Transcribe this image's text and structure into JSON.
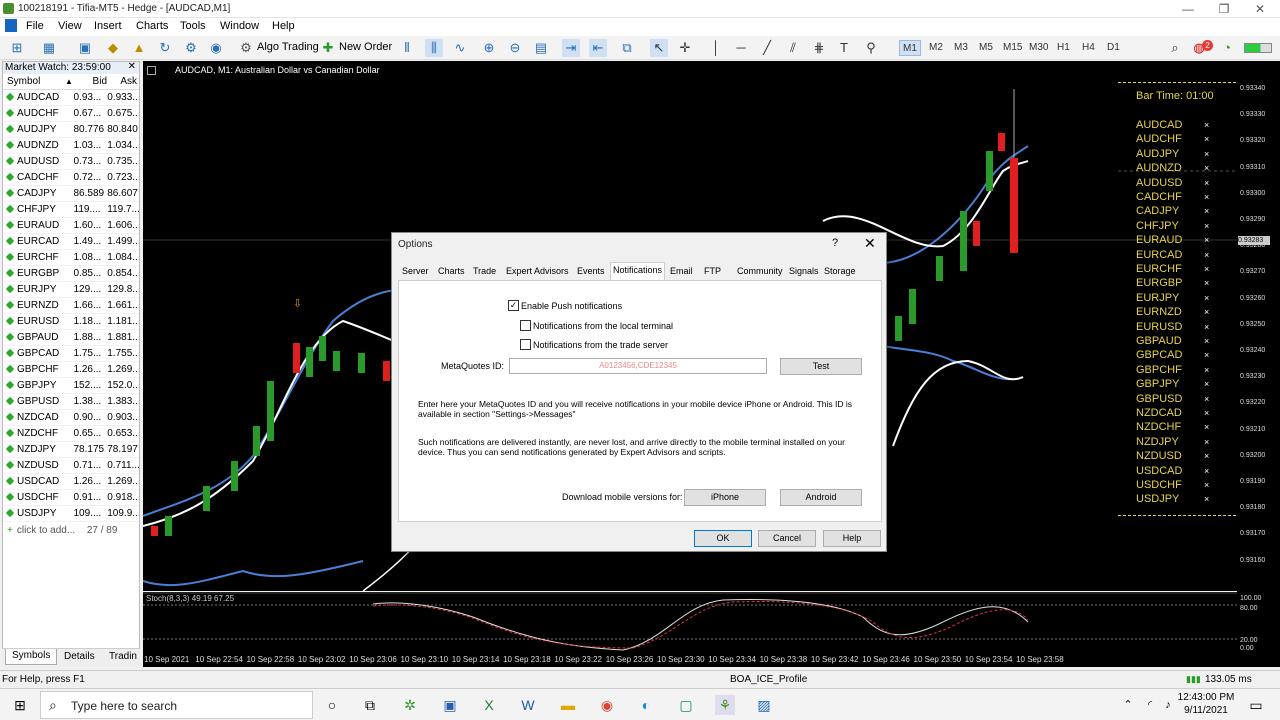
{
  "window": {
    "title": "100218191 - Tifia-MT5 - Hedge - [AUDCAD,M1]"
  },
  "menu": [
    "File",
    "View",
    "Insert",
    "Charts",
    "Tools",
    "Window",
    "Help"
  ],
  "toolbar": {
    "algo_trading": "Algo Trading",
    "new_order": "New Order",
    "timeframes": [
      "M1",
      "M2",
      "M3",
      "M5",
      "M15",
      "M30",
      "H1",
      "H4",
      "D1"
    ],
    "active_timeframe": "M1",
    "notif_count": "2"
  },
  "market_watch": {
    "title": "Market Watch: 23:59:00",
    "headers": {
      "symbol": "Symbol",
      "bid": "Bid",
      "ask": "Ask"
    },
    "rows": [
      {
        "symbol": "AUDCAD",
        "bid": "0.93...",
        "ask": "0.933..."
      },
      {
        "symbol": "AUDCHF",
        "bid": "0.67...",
        "ask": "0.675..."
      },
      {
        "symbol": "AUDJPY",
        "bid": "80.776",
        "ask": "80.840"
      },
      {
        "symbol": "AUDNZD",
        "bid": "1.03...",
        "ask": "1.034..."
      },
      {
        "symbol": "AUDUSD",
        "bid": "0.73...",
        "ask": "0.735..."
      },
      {
        "symbol": "CADCHF",
        "bid": "0.72...",
        "ask": "0.723..."
      },
      {
        "symbol": "CADJPY",
        "bid": "86.589",
        "ask": "86.607"
      },
      {
        "symbol": "CHFJPY",
        "bid": "119....",
        "ask": "119.7..."
      },
      {
        "symbol": "EURAUD",
        "bid": "1.60...",
        "ask": "1.606..."
      },
      {
        "symbol": "EURCAD",
        "bid": "1.49...",
        "ask": "1.499..."
      },
      {
        "symbol": "EURCHF",
        "bid": "1.08...",
        "ask": "1.084..."
      },
      {
        "symbol": "EURGBP",
        "bid": "0.85...",
        "ask": "0.854..."
      },
      {
        "symbol": "EURJPY",
        "bid": "129....",
        "ask": "129.8..."
      },
      {
        "symbol": "EURNZD",
        "bid": "1.66...",
        "ask": "1.661..."
      },
      {
        "symbol": "EURUSD",
        "bid": "1.18...",
        "ask": "1.181..."
      },
      {
        "symbol": "GBPAUD",
        "bid": "1.88...",
        "ask": "1.881..."
      },
      {
        "symbol": "GBPCAD",
        "bid": "1.75...",
        "ask": "1.755..."
      },
      {
        "symbol": "GBPCHF",
        "bid": "1.26...",
        "ask": "1.269..."
      },
      {
        "symbol": "GBPJPY",
        "bid": "152....",
        "ask": "152.0..."
      },
      {
        "symbol": "GBPUSD",
        "bid": "1.38...",
        "ask": "1.383..."
      },
      {
        "symbol": "NZDCAD",
        "bid": "0.90...",
        "ask": "0.903..."
      },
      {
        "symbol": "NZDCHF",
        "bid": "0.65...",
        "ask": "0.653..."
      },
      {
        "symbol": "NZDJPY",
        "bid": "78.175",
        "ask": "78.197"
      },
      {
        "symbol": "NZDUSD",
        "bid": "0.71...",
        "ask": "0.711..."
      },
      {
        "symbol": "USDCAD",
        "bid": "1.26...",
        "ask": "1.269..."
      },
      {
        "symbol": "USDCHF",
        "bid": "0.91...",
        "ask": "0.918..."
      },
      {
        "symbol": "USDJPY",
        "bid": "109....",
        "ask": "109.9..."
      }
    ],
    "add_label": "click to add...",
    "count": "27 / 89",
    "tabs": [
      "Symbols",
      "Details",
      "Tradin"
    ]
  },
  "chart": {
    "title": "AUDCAD, M1:  Australian Dollar vs Canadian Dollar",
    "price_labels": [
      "0.93340",
      "0.93330",
      "0.93320",
      "0.93310",
      "0.93300",
      "0.93290",
      "0.93280",
      "0.93270",
      "0.93260",
      "0.93250",
      "0.93240",
      "0.93230",
      "0.93220",
      "0.93210",
      "0.93200",
      "0.93190",
      "0.93180",
      "0.93170",
      "0.93160"
    ],
    "current_price": "0.93283",
    "stoch_label": "Stoch(8,3,3) 49.19 67.25",
    "stoch_levels": [
      "100.00",
      "80.00",
      "20.00",
      "0.00"
    ],
    "time_labels": [
      "10 Sep 2021",
      "10 Sep 22:54",
      "10 Sep 22:58",
      "10 Sep 23:02",
      "10 Sep 23:06",
      "10 Sep 23:10",
      "10 Sep 23:14",
      "10 Sep 23:18",
      "10 Sep 23:22",
      "10 Sep 23:26",
      "10 Sep 23:30",
      "10 Sep 23:34",
      "10 Sep 23:38",
      "10 Sep 23:42",
      "10 Sep 23:46",
      "10 Sep 23:50",
      "10 Sep 23:54",
      "10 Sep 23:58"
    ],
    "panel": {
      "bar_time": "Bar Time: 01:00",
      "symbols": [
        "AUDCAD",
        "AUDCHF",
        "AUDJPY",
        "AUDNZD",
        "AUDUSD",
        "CADCHF",
        "CADJPY",
        "CHFJPY",
        "EURAUD",
        "EURCAD",
        "EURCHF",
        "EURGBP",
        "EURJPY",
        "EURNZD",
        "EURUSD",
        "GBPAUD",
        "GBPCAD",
        "GBPCHF",
        "GBPJPY",
        "GBPUSD",
        "NZDCAD",
        "NZDCHF",
        "NZDJPY",
        "NZDUSD",
        "USDCAD",
        "USDCHF",
        "USDJPY"
      ],
      "remove_glyph": "×"
    }
  },
  "dialog": {
    "title": "Options",
    "help_glyph": "?",
    "close_glyph": "✕",
    "tabs": [
      "Server",
      "Charts",
      "Trade",
      "Expert Advisors",
      "Events",
      "Notifications",
      "Email",
      "FTP",
      "Community",
      "Signals",
      "Storage"
    ],
    "active_tab": "Notifications",
    "enable_push": "Enable Push notifications",
    "enable_push_checked": true,
    "from_local": "Notifications from the local terminal",
    "from_local_checked": false,
    "from_server": "Notifications from the trade server",
    "from_server_checked": false,
    "metaquotes_label": "MetaQuotes ID:",
    "metaquotes_placeholder": "A0123456,CDE12345",
    "test_button": "Test",
    "para1": "Enter here your MetaQuotes ID and you will receive notifications in your mobile device iPhone or Android. This ID is available in section \"Settings->Messages\"",
    "para2": "Such notifications are delivered instantly, are never lost, and arrive directly to the mobile terminal installed on your device. Thus you can send notifications generated by Expert Advisors and scripts.",
    "download_label": "Download mobile versions for:",
    "iphone_button": "iPhone",
    "android_button": "Android",
    "ok_button": "OK",
    "cancel_button": "Cancel",
    "help_button": "Help"
  },
  "status": {
    "help_text": "For Help, press F1",
    "profile": "BOA_ICE_Profile",
    "ping": "133.05 ms"
  },
  "taskbar": {
    "search_placeholder": "Type here to search",
    "time": "12:43:00 PM",
    "date": "9/11/2021"
  }
}
